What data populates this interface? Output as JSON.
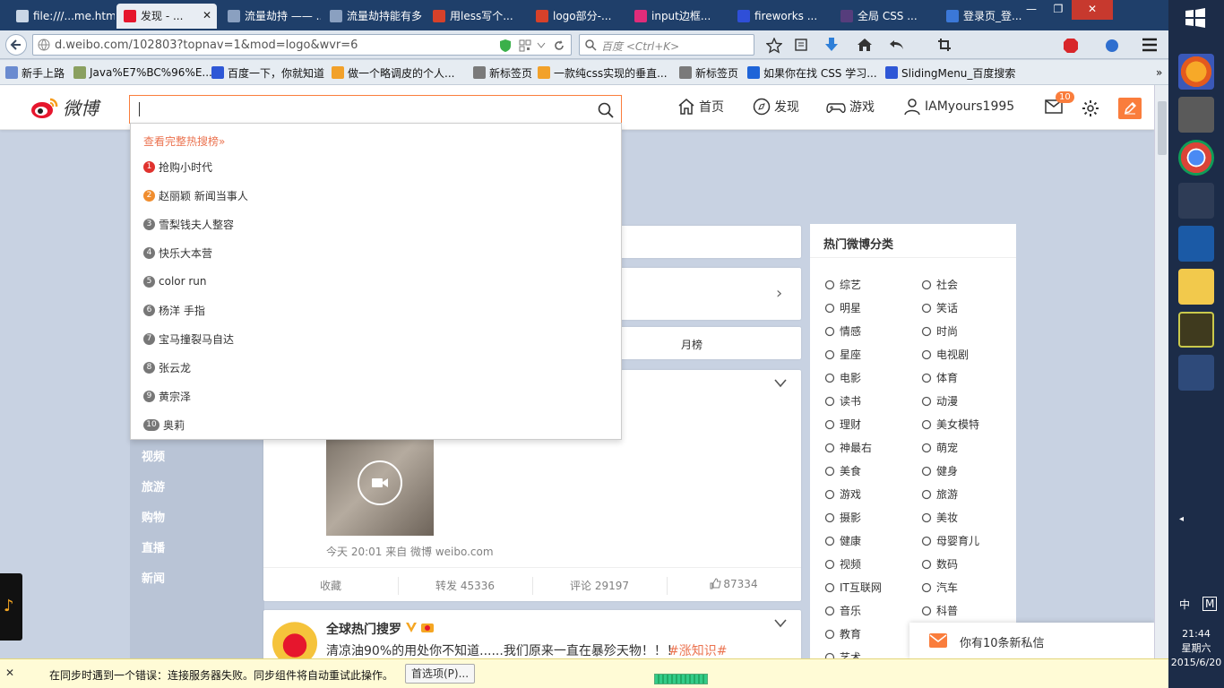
{
  "browser": {
    "tabs": [
      {
        "label": "file:///...me.html",
        "favicon_color": "#c9d6e6"
      },
      {
        "label": "发现 - ...",
        "favicon_color": "#e6162d"
      },
      {
        "label": "流量劫持 —— ...",
        "favicon_color": "#8aa0c0"
      },
      {
        "label": "流量劫持能有多...",
        "favicon_color": "#8aa0c0"
      },
      {
        "label": "用less写个...",
        "favicon_color": "#d6412a"
      },
      {
        "label": "logo部分-...",
        "favicon_color": "#d6412a"
      },
      {
        "label": "input边框...",
        "favicon_color": "#e02c7a"
      },
      {
        "label": "fireworks ...",
        "favicon_color": "#2f4fd8"
      },
      {
        "label": "全局 CSS ...",
        "favicon_color": "#563d7c"
      },
      {
        "label": "登录页_登...",
        "favicon_color": "#3b78d8"
      }
    ],
    "tab_close": "✕",
    "window_controls": {
      "minimize": "—",
      "maximize": "❐",
      "close": "✕"
    },
    "url": "d.weibo.com/102803?topnav=1&mod=logo&wvr=6",
    "search_placeholder": "百度 <Ctrl+K>",
    "bookmarks": [
      {
        "label": "新手上路",
        "color": "#6a8bd0"
      },
      {
        "label": "Java%E7%BC%96%E...",
        "color": "#8aa060"
      },
      {
        "label": "百度一下，你就知道",
        "color": "#2e57d6"
      },
      {
        "label": "做一个略调皮的个人...",
        "color": "#f2a12a"
      },
      {
        "label": "新标签页",
        "color": "#7a7a7a"
      },
      {
        "label": "一款纯css实现的垂直...",
        "color": "#f2a12a"
      },
      {
        "label": "新标签页",
        "color": "#7a7a7a"
      },
      {
        "label": "如果你在找 CSS 学习...",
        "color": "#1e64d8"
      },
      {
        "label": "SlidingMenu_百度搜索",
        "color": "#2e57d6"
      }
    ],
    "bookmarks_more": "»"
  },
  "weibo": {
    "logo_text": "微博",
    "brand_color": "#fa7d3c",
    "nav": {
      "home": "首页",
      "discover": "发现",
      "game": "游戏",
      "user": "IAMyours1995",
      "msg_badge": "10"
    },
    "suggest": {
      "hot_link": "查看完整热搜榜»",
      "items": [
        {
          "rank": "1",
          "text": "抢购小时代"
        },
        {
          "rank": "2",
          "text": "赵丽颖 新闻当事人"
        },
        {
          "rank": "3",
          "text": "雪梨钱夫人整容"
        },
        {
          "rank": "4",
          "text": "快乐大本营"
        },
        {
          "rank": "5",
          "text": "color run"
        },
        {
          "rank": "6",
          "text": "杨洋 手指"
        },
        {
          "rank": "7",
          "text": "宝马撞裂马自达"
        },
        {
          "rank": "8",
          "text": "张云龙"
        },
        {
          "rank": "9",
          "text": "黄宗泽"
        },
        {
          "rank": "10",
          "text": "奥莉"
        }
      ]
    },
    "left_menu": [
      "视频",
      "旅游",
      "购物",
      "直播",
      "新闻"
    ],
    "tab_monthly": "月榜",
    "post1": {
      "meta": "今天 20:01 来自 微博 weibo.com",
      "actions": {
        "collect": "收藏",
        "repost": "转发 45336",
        "comment": "评论 29197",
        "like": "87334"
      }
    },
    "post2": {
      "author": "全球热门搜罗",
      "text": "清凉油90%的用处你不知道......我们原来一直在暴殄天物！！！",
      "tag": "#涨知识#"
    },
    "right": {
      "title": "热门微博分类",
      "cats_left": [
        "综艺",
        "明星",
        "情感",
        "星座",
        "电影",
        "读书",
        "理财",
        "神最右",
        "美食",
        "游戏",
        "摄影",
        "健康",
        "视频",
        "IT互联网",
        "音乐",
        "教育",
        "艺术"
      ],
      "cats_right": [
        "社会",
        "笑话",
        "时尚",
        "电视剧",
        "体育",
        "动漫",
        "美女模特",
        "萌宠",
        "健身",
        "旅游",
        "美妆",
        "母婴育儿",
        "数码",
        "汽车",
        "科普",
        "",
        ""
      ]
    },
    "toast": "你有10条新私信",
    "chevron": "›"
  },
  "sync_bar": {
    "close": "✕",
    "message": "在同步时遇到一个错误：连接服务器失败。同步组件将自动重试此操作。",
    "button": "首选项(P)..."
  },
  "taskbar": {
    "time": "21:44",
    "weekday": "星期六",
    "date": "2015/6/20",
    "ime": "中",
    "ime2": "M"
  }
}
